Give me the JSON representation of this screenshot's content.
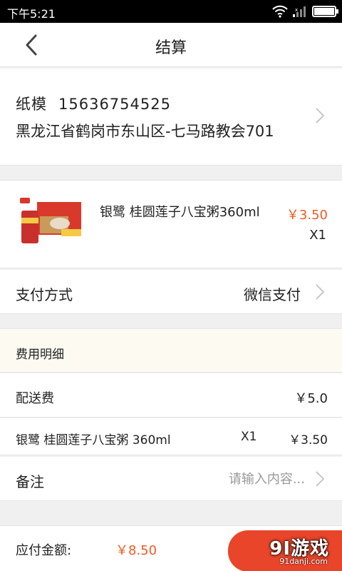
{
  "status_bar": {
    "time": "下午5:21"
  },
  "header": {
    "title": "结算"
  },
  "address": {
    "name": "纸模",
    "phone": "15636754525",
    "detail": "黑龙江省鹤岗市东山区-七马路教会701"
  },
  "product": {
    "name": "银鹭 桂圆莲子八宝粥360ml",
    "price": "￥3.50",
    "qty": "X1"
  },
  "payment": {
    "label": "支付方式",
    "value": "微信支付"
  },
  "fees": {
    "header": "费用明细",
    "delivery_label": "配送费",
    "delivery_value": "￥5.0",
    "item_label": "银鹭 桂圆莲子八宝粥 360ml",
    "item_qty": "X1",
    "item_value": "￥3.50"
  },
  "remark": {
    "label": "备注",
    "placeholder": "请输入内容..."
  },
  "footer": {
    "total_label": "应付金额:",
    "total_amount": "￥8.50"
  },
  "watermark": {
    "logo": "9Ⅰ游戏",
    "site": "91danji.com"
  },
  "colors": {
    "accent": "#f05a22",
    "button": "#e8452a",
    "fee_header_bg": "#fcfaf1"
  },
  "icons": [
    "back-arrow-icon",
    "chevron-right-icon",
    "wifi-icon",
    "signal-icon",
    "battery-icon"
  ]
}
